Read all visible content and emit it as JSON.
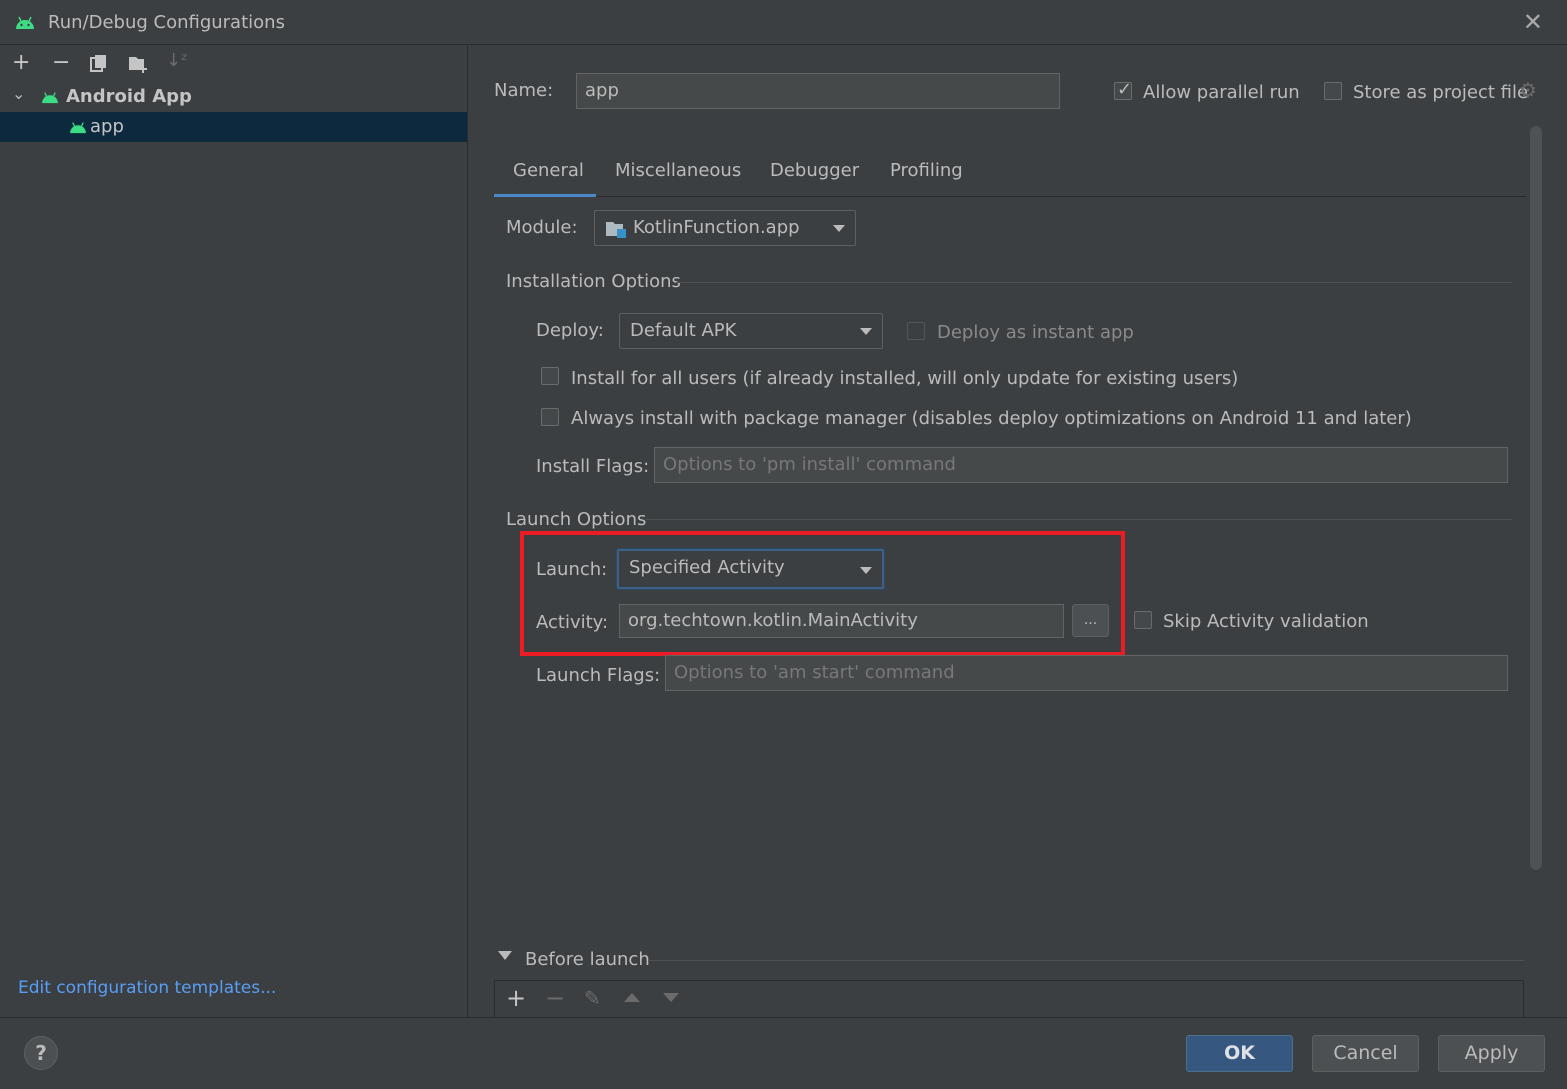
{
  "window": {
    "title": "Run/Debug Configurations"
  },
  "sidebar": {
    "tree": [
      {
        "label": "Android App",
        "expanded": true
      },
      {
        "label": "app",
        "selected": true
      }
    ],
    "edit_templates_link": "Edit configuration templates..."
  },
  "header": {
    "name_label": "Name:",
    "name_value": "app",
    "allow_parallel_label": "Allow parallel run",
    "allow_parallel_checked": true,
    "store_project_label": "Store as project file",
    "store_project_checked": false
  },
  "tabs": [
    {
      "label": "General",
      "active": true
    },
    {
      "label": "Miscellaneous"
    },
    {
      "label": "Debugger"
    },
    {
      "label": "Profiling"
    }
  ],
  "general": {
    "module_label": "Module:",
    "module_value": "KotlinFunction.app",
    "installation_section": "Installation Options",
    "deploy_label": "Deploy:",
    "deploy_value": "Default APK",
    "deploy_instant_label": "Deploy as instant app",
    "install_all_users_label": "Install for all users (if already installed, will only update for existing users)",
    "always_install_pm_label": "Always install with package manager (disables deploy optimizations on Android 11 and later)",
    "install_flags_label": "Install Flags:",
    "install_flags_placeholder": "Options to 'pm install' command",
    "launch_section": "Launch Options",
    "launch_label": "Launch:",
    "launch_value": "Specified Activity",
    "activity_label": "Activity:",
    "activity_value": "org.techtown.kotlin.MainActivity",
    "browse_label": "...",
    "skip_validation_label": "Skip Activity validation",
    "launch_flags_label": "Launch Flags:",
    "launch_flags_placeholder": "Options to 'am start' command"
  },
  "before_launch": {
    "label": "Before launch"
  },
  "buttons": {
    "ok": "OK",
    "cancel": "Cancel",
    "apply": "Apply",
    "help": "?"
  },
  "colors": {
    "background": "#3c3f41",
    "accent": "#4a88c7",
    "highlight": "#ec1c24",
    "link": "#589df6"
  }
}
